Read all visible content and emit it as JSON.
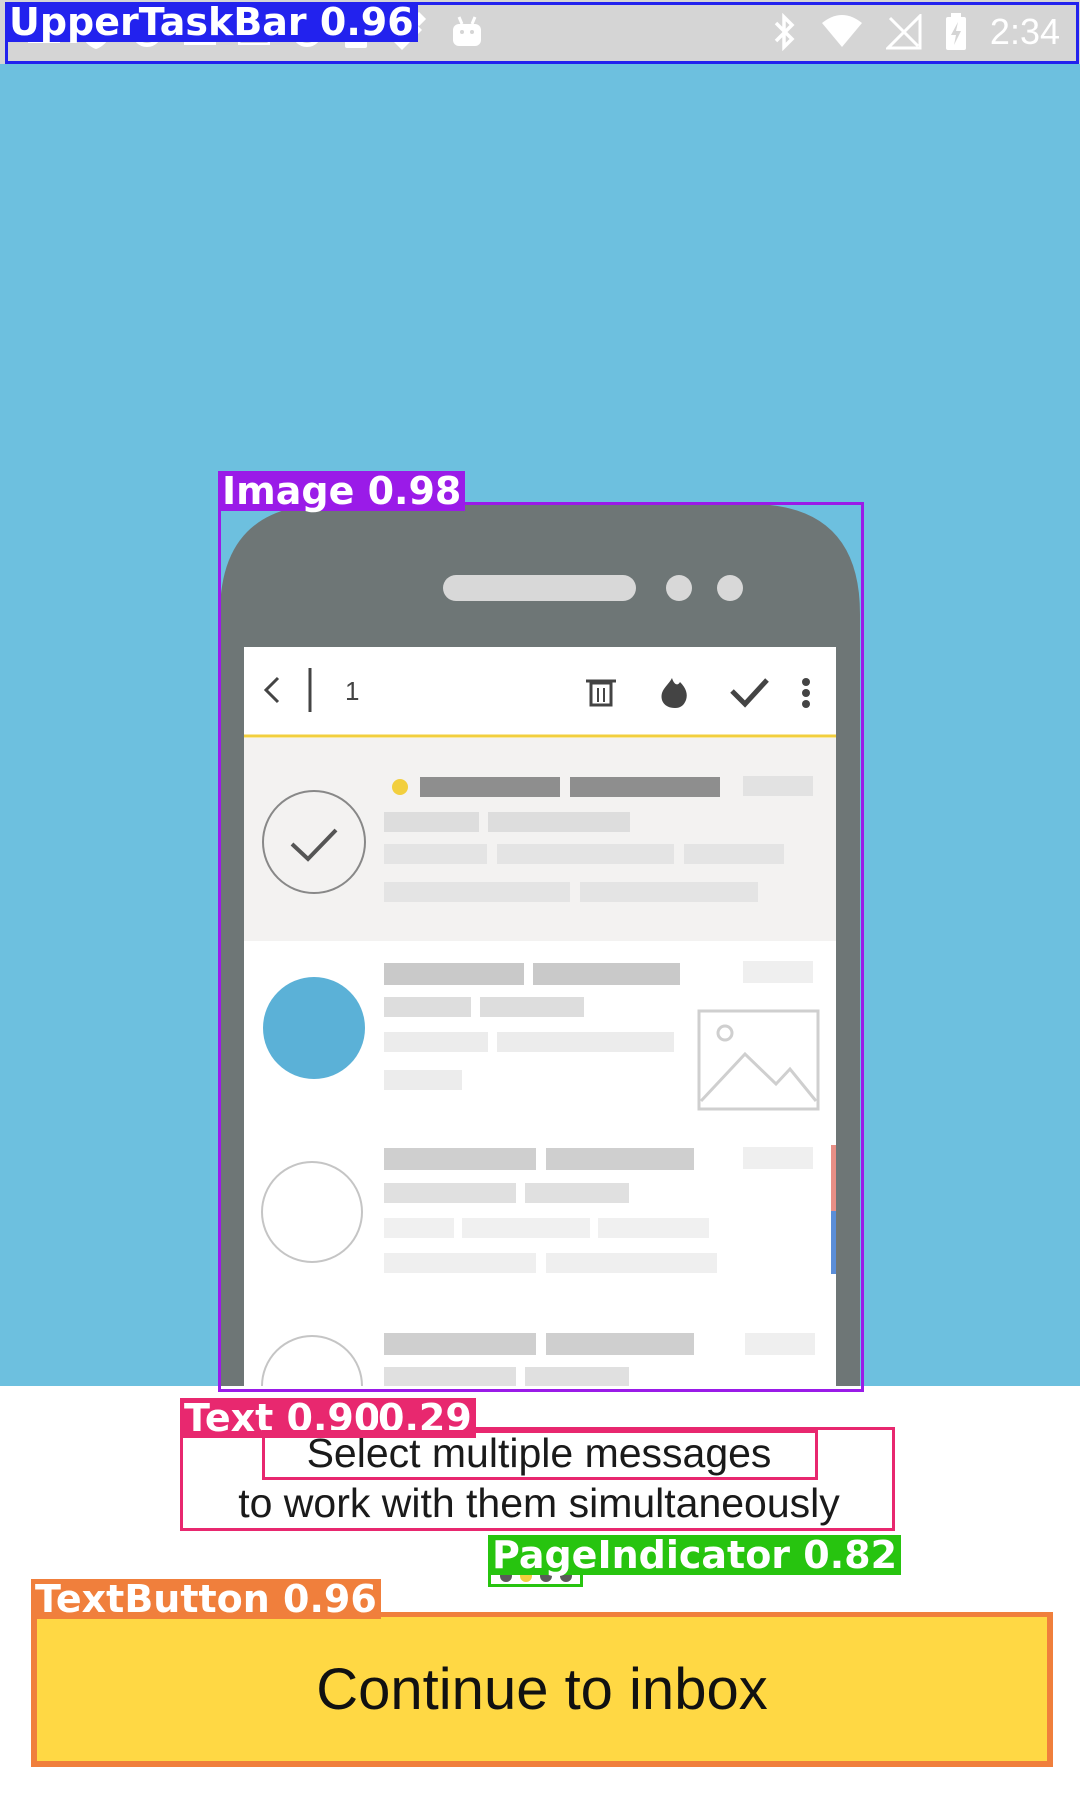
{
  "status_bar": {
    "time": "2:34",
    "left_icons": [
      "gmail-icon",
      "shield-icon",
      "sync-icon",
      "photo-icon",
      "landscape-icon",
      "fax-icon",
      "location-icon",
      "lock-icon",
      "satellite-icon",
      "android-icon"
    ],
    "right_icons": [
      "bluetooth-icon",
      "wifi-icon",
      "no-signal-icon",
      "battery-charging-icon"
    ]
  },
  "illustration": {
    "selected_count": "1"
  },
  "onboarding": {
    "message_line1": "Select multiple messages",
    "message_line2": "to work with them simultaneously",
    "page_count": 4,
    "active_page": 2
  },
  "cta": {
    "label": "Continue to inbox"
  },
  "annotations": [
    {
      "label": "UpperTaskBar  0.96",
      "color": "#2222ee"
    },
    {
      "label": "Image  0.98",
      "color": "#9a1be8"
    },
    {
      "label": "Text  0.90",
      "color": "#e8286f"
    },
    {
      "label": "0.29",
      "color": "#e8286f"
    },
    {
      "label": "PageIndicator  0.82",
      "color": "#27c40f"
    },
    {
      "label": "TextButton  0.96",
      "color": "#f07f3c"
    }
  ],
  "colors": {
    "hero_blue": "#6dc0df",
    "button_yellow": "#ffd844",
    "accent_yellow": "#f2cf3e",
    "phone_gray": "#6e7676"
  }
}
